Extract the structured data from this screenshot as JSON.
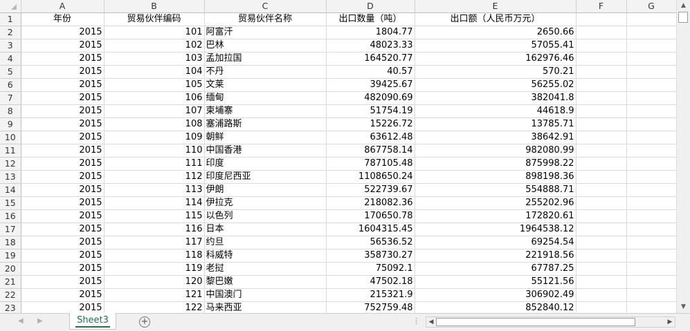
{
  "columns": [
    "A",
    "B",
    "C",
    "D",
    "E",
    "F",
    "G"
  ],
  "header_row": {
    "num": "1",
    "year": "年份",
    "partner_code": "贸易伙伴编码",
    "partner_name": "贸易伙伴名称",
    "export_qty": "出口数量（吨）",
    "export_value": "出口额（人民币万元）"
  },
  "rows": [
    {
      "num": "2",
      "year": "2015",
      "code": "101",
      "name": "阿富汗",
      "qty": "1804.77",
      "value": "2650.66"
    },
    {
      "num": "3",
      "year": "2015",
      "code": "102",
      "name": "巴林",
      "qty": "48023.33",
      "value": "57055.41"
    },
    {
      "num": "4",
      "year": "2015",
      "code": "103",
      "name": "孟加拉国",
      "qty": "164520.77",
      "value": "162976.46"
    },
    {
      "num": "5",
      "year": "2015",
      "code": "104",
      "name": "不丹",
      "qty": "40.57",
      "value": "570.21"
    },
    {
      "num": "6",
      "year": "2015",
      "code": "105",
      "name": "文莱",
      "qty": "39425.67",
      "value": "56255.02"
    },
    {
      "num": "7",
      "year": "2015",
      "code": "106",
      "name": "缅甸",
      "qty": "482090.69",
      "value": "382041.8"
    },
    {
      "num": "8",
      "year": "2015",
      "code": "107",
      "name": "柬埔寨",
      "qty": "51754.19",
      "value": "44618.9"
    },
    {
      "num": "9",
      "year": "2015",
      "code": "108",
      "name": "塞浦路斯",
      "qty": "15226.72",
      "value": "13785.71"
    },
    {
      "num": "10",
      "year": "2015",
      "code": "109",
      "name": "朝鲜",
      "qty": "63612.48",
      "value": "38642.91"
    },
    {
      "num": "11",
      "year": "2015",
      "code": "110",
      "name": "中国香港",
      "qty": "867758.14",
      "value": "982080.99"
    },
    {
      "num": "12",
      "year": "2015",
      "code": "111",
      "name": "印度",
      "qty": "787105.48",
      "value": "875998.22"
    },
    {
      "num": "13",
      "year": "2015",
      "code": "112",
      "name": "印度尼西亚",
      "qty": "1108650.24",
      "value": "898198.36"
    },
    {
      "num": "14",
      "year": "2015",
      "code": "113",
      "name": "伊朗",
      "qty": "522739.67",
      "value": "554888.71"
    },
    {
      "num": "15",
      "year": "2015",
      "code": "114",
      "name": "伊拉克",
      "qty": "218082.36",
      "value": "255202.96"
    },
    {
      "num": "16",
      "year": "2015",
      "code": "115",
      "name": "以色列",
      "qty": "170650.78",
      "value": "172820.61"
    },
    {
      "num": "17",
      "year": "2015",
      "code": "116",
      "name": "日本",
      "qty": "1604315.45",
      "value": "1964538.12"
    },
    {
      "num": "18",
      "year": "2015",
      "code": "117",
      "name": "约旦",
      "qty": "56536.52",
      "value": "69254.54"
    },
    {
      "num": "19",
      "year": "2015",
      "code": "118",
      "name": "科威特",
      "qty": "358730.27",
      "value": "221918.56"
    },
    {
      "num": "20",
      "year": "2015",
      "code": "119",
      "name": "老挝",
      "qty": "75092.1",
      "value": "67787.25"
    },
    {
      "num": "21",
      "year": "2015",
      "code": "120",
      "name": "黎巴嫩",
      "qty": "47502.18",
      "value": "55121.56"
    },
    {
      "num": "22",
      "year": "2015",
      "code": "121",
      "name": "中国澳门",
      "qty": "215321.9",
      "value": "306902.49"
    },
    {
      "num": "23",
      "year": "2015",
      "code": "122",
      "name": "马来西亚",
      "qty": "752759.48",
      "value": "852840.12"
    }
  ],
  "sheet_tab": "Sheet3",
  "add_sheet_symbol": "+"
}
